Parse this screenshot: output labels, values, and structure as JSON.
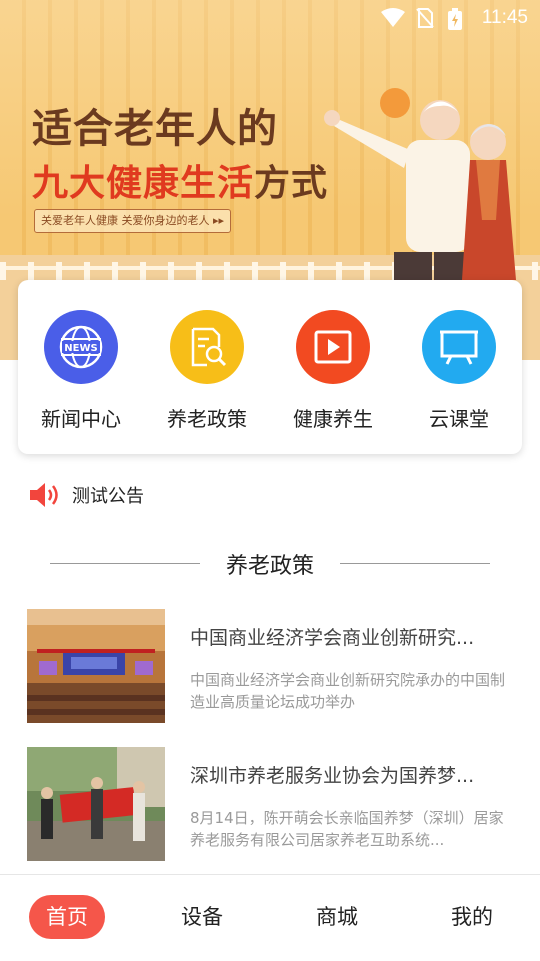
{
  "status_bar": {
    "time": "11:45"
  },
  "banner": {
    "title_line1": "适合老年人的",
    "title_line2_red": "九大健康生活",
    "title_line2_dark": "方式",
    "tagline": "关爱老年人健康 关爱你身边的老人 ▸▸"
  },
  "quick_menu": [
    {
      "label": "新闻中心",
      "icon": "news-globe-icon",
      "color": "#4a5ee8"
    },
    {
      "label": "养老政策",
      "icon": "document-search-icon",
      "color": "#f7be18"
    },
    {
      "label": "健康养生",
      "icon": "video-play-icon",
      "color": "#f24a21"
    },
    {
      "label": "云课堂",
      "icon": "presentation-board-icon",
      "color": "#22aaf0"
    }
  ],
  "notice": {
    "text": "测试公告",
    "icon": "speaker-icon"
  },
  "section": {
    "title": "养老政策"
  },
  "articles": [
    {
      "title": "中国商业经济学会商业创新研究...",
      "desc": "中国商业经济学会商业创新研究院承办的中国制造业高质量论坛成功举办"
    },
    {
      "title": "深圳市养老服务业协会为国养梦...",
      "desc": "8月14日，陈开萌会长亲临国养梦（深圳）居家养老服务有限公司居家养老互助系统..."
    }
  ],
  "tabs": [
    {
      "label": "首页",
      "active": true
    },
    {
      "label": "设备",
      "active": false
    },
    {
      "label": "商城",
      "active": false
    },
    {
      "label": "我的",
      "active": false
    }
  ],
  "colors": {
    "accent": "#f5564a"
  }
}
